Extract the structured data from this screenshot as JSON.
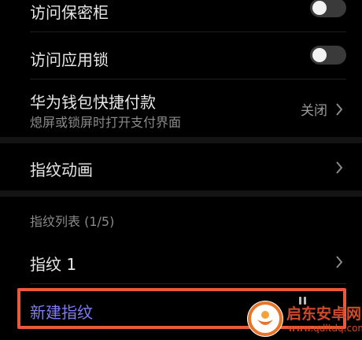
{
  "items": {
    "safe": {
      "label": "访问保密柜"
    },
    "applock": {
      "label": "访问应用锁"
    },
    "wallet": {
      "label": "华为钱包快捷付款",
      "sublabel": "熄屏或锁屏时打开支付界面",
      "value": "关闭"
    },
    "animation": {
      "label": "指纹动画"
    }
  },
  "fingerprint_list": {
    "title": "指纹列表 (1/5)",
    "entries": [
      {
        "label": "指纹 1"
      }
    ],
    "new_label": "新建指纹"
  },
  "watermark": {
    "title": "启东安卓网",
    "url": "www.qdltdq.com"
  },
  "colors": {
    "accent": "#7f7cf0",
    "highlight": "#e85a3a"
  }
}
